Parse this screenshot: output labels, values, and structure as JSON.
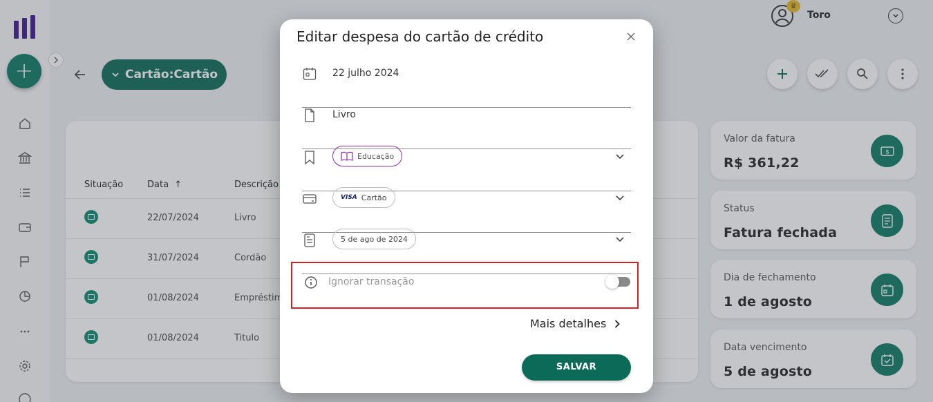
{
  "colors": {
    "brand_green": "#0b6b58",
    "highlight_red": "#e01e1e",
    "logo_purple": "#3a1a8a",
    "category_purple": "#8a2bb9"
  },
  "header": {
    "user_name": "Toro",
    "account_label": "Cartão:Cartão"
  },
  "table": {
    "columns": [
      "Situação",
      "Data",
      "Descrição"
    ],
    "rows": [
      {
        "date": "22/07/2024",
        "description": "Livro"
      },
      {
        "date": "31/07/2024",
        "description": "Cordão"
      },
      {
        "date": "01/08/2024",
        "description": "Empréstimo"
      },
      {
        "date": "01/08/2024",
        "description": "Titulo"
      }
    ]
  },
  "summary_cards": [
    {
      "label": "Valor da fatura",
      "value": "R$ 361,22",
      "icon": "money-icon"
    },
    {
      "label": "Status",
      "value": "Fatura fechada",
      "icon": "invoice-icon"
    },
    {
      "label": "Dia de fechamento",
      "value": "1 de agosto",
      "icon": "calendar-icon"
    },
    {
      "label": "Data vencimento",
      "value": "5 de agosto",
      "icon": "calendar-check-icon"
    }
  ],
  "modal": {
    "title": "Editar despesa do cartão de crédito",
    "date": "22 julho 2024",
    "description": "Livro",
    "category": "Educação",
    "card_brand": "VISA",
    "card_name": "Cartão",
    "invoice": "5 de ago de 2024",
    "ignore_label": "Ignorar transação",
    "ignore_enabled": false,
    "more_details": "Mais detalhes",
    "save": "SALVAR"
  }
}
